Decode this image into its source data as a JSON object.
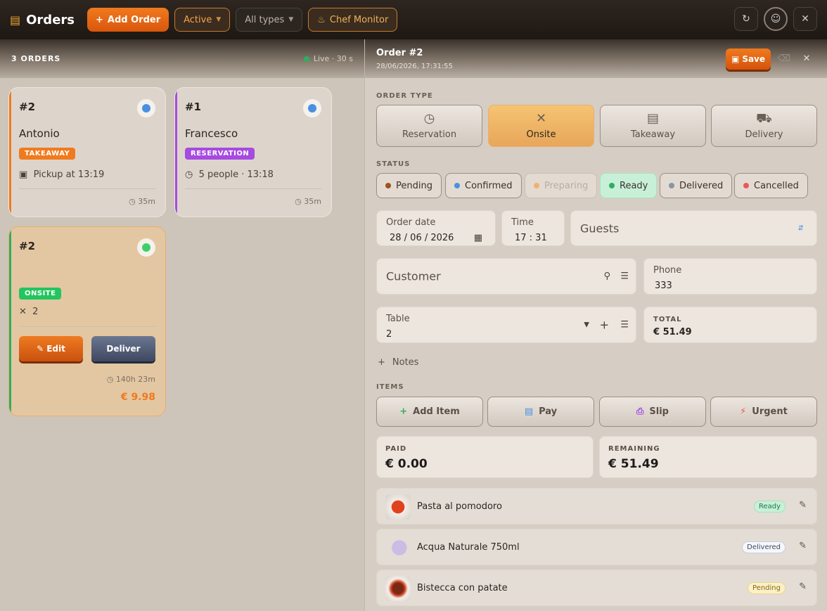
{
  "topbar": {
    "title": "Orders",
    "add_label": "Add Order",
    "filter_active": "Active",
    "filter_types": "All types",
    "chef_label": "Chef Monitor"
  },
  "left": {
    "count_label": "3 ORDERS",
    "live_label": "Live · 30 s",
    "live_color": "#2fae5f",
    "cards": [
      {
        "num": "#2",
        "name": "Antonio",
        "badge": "TAKEAWAY",
        "badge_color": "#f07a1e",
        "bar_color": "#f07a1e",
        "status_color": "#4a90e2",
        "meta": "Pickup at 13:19",
        "time": "35m"
      },
      {
        "num": "#1",
        "name": "Francesco",
        "badge": "RESERVATION",
        "badge_color": "#a64ae0",
        "bar_color": "#a64ae0",
        "status_color": "#4a90e2",
        "meta": "5 people · 13:18",
        "time": "35m"
      },
      {
        "num": "#2",
        "name": "",
        "badge": "ONSITE",
        "badge_color": "#22c55e",
        "bar_color": "#2fae5f",
        "status_color": "#3fcf6a",
        "meta": "2",
        "time": "140h 23m",
        "total": "€ 9.98",
        "edit_label": "Edit",
        "deliver_label": "Deliver"
      }
    ]
  },
  "order": {
    "title": "Order #2",
    "datetime": "28/06/2026, 17:31:55",
    "save_label": "Save",
    "order_type_label": "ORDER TYPE",
    "types": [
      "Reservation",
      "Onsite",
      "Takeaway",
      "Delivery"
    ],
    "selected_type": "Onsite",
    "status_label": "STATUS",
    "statuses": [
      {
        "label": "Pending",
        "color": "#a0521e"
      },
      {
        "label": "Confirmed",
        "color": "#4a90e2"
      },
      {
        "label": "Preparing",
        "color": "#f0b070"
      },
      {
        "label": "Ready",
        "color": "#2fae5f"
      },
      {
        "label": "Delivered",
        "color": "#8a94a6"
      },
      {
        "label": "Cancelled",
        "color": "#e85a5a"
      }
    ],
    "selected_status": "Ready",
    "order_date_label": "Order date",
    "order_date": "28 / 06 / 2026",
    "time_label": "Time",
    "time": "17 : 31",
    "guests_placeholder": "Guests",
    "customer_placeholder": "Customer",
    "phone_label": "Phone",
    "phone": "333",
    "table_label": "Table",
    "table": "2",
    "total_label": "TOTAL",
    "total": "€ 51.49",
    "notes_label": "Notes",
    "items_label": "ITEMS",
    "actions": [
      "Add Item",
      "Pay",
      "Slip",
      "Urgent"
    ],
    "paid_label": "PAID",
    "paid": "€ 0.00",
    "remaining_label": "REMAINING",
    "remaining": "€ 51.49",
    "items": [
      {
        "name": "Pasta al pomodoro",
        "status": "Ready"
      },
      {
        "name": "Acqua Naturale 750ml",
        "status": "Delivered"
      },
      {
        "name": "Bistecca con patate",
        "status": "Pending"
      }
    ]
  }
}
